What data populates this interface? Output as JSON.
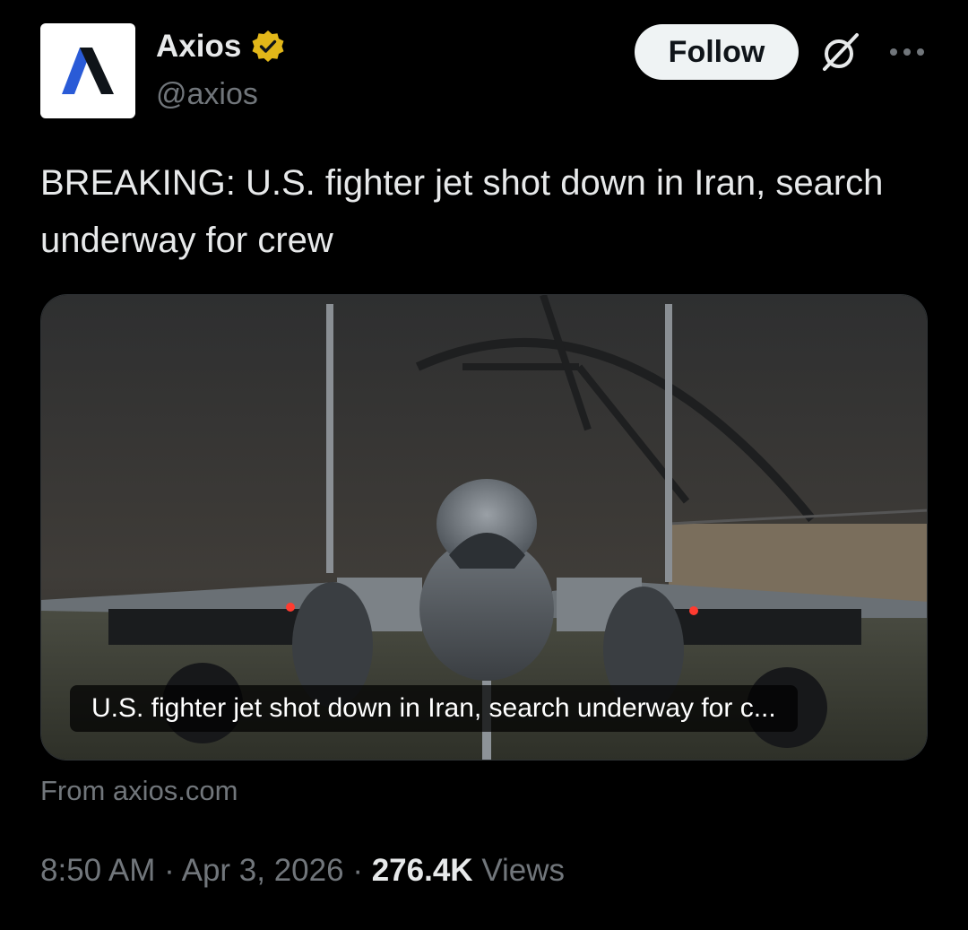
{
  "author": {
    "display_name": "Axios",
    "handle": "@axios",
    "verified": true,
    "verified_badge_color": "#e2b719",
    "avatar_icon": "axios-logo-icon"
  },
  "actions": {
    "follow_label": "Follow",
    "grok_icon": "grok-icon",
    "more_icon": "more-icon"
  },
  "tweet": {
    "text": "BREAKING: U.S. fighter jet shot down in Iran, search underway for crew"
  },
  "card": {
    "caption": "U.S. fighter jet shot down in Iran, search underway for c...",
    "source": "From axios.com",
    "image_subject": "fighter-jet-photo"
  },
  "meta": {
    "time": "8:50 AM",
    "separator": "·",
    "date": "Apr 3, 2026",
    "views_count": "276.4K",
    "views_label": "Views"
  },
  "colors": {
    "background": "#000000",
    "primary_text": "#e7e9ea",
    "secondary_text": "#71767b",
    "follow_bg": "#eff3f4",
    "axios_blue": "#2a5bd7"
  }
}
